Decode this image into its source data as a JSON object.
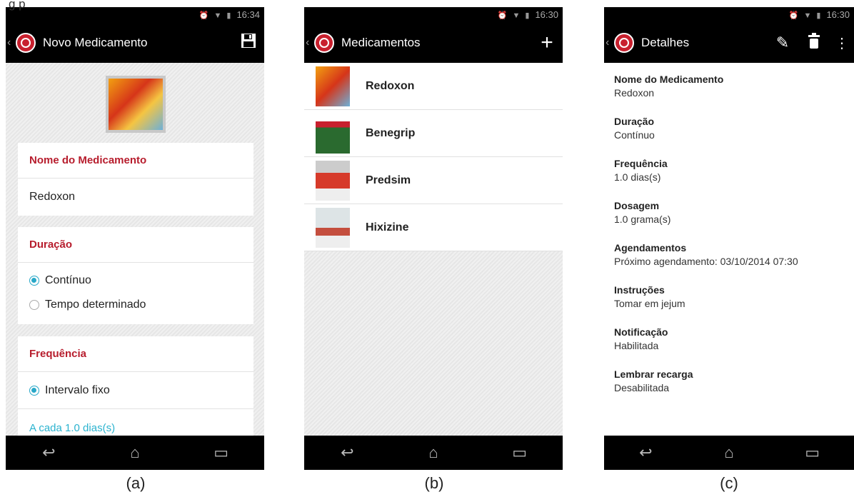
{
  "figure": {
    "caption_fragment": "g                             p",
    "panel_labels": [
      "(a)",
      "(b)",
      "(c)"
    ]
  },
  "panel_a": {
    "status_time": "16:34",
    "title": "Novo Medicamento",
    "save_icon": "save-icon",
    "sections": {
      "nome": {
        "header": "Nome do Medicamento",
        "value": "Redoxon"
      },
      "duracao": {
        "header": "Duração",
        "options": [
          "Contínuo",
          "Tempo determinado"
        ],
        "selected": 0
      },
      "frequencia": {
        "header": "Frequência",
        "option": "Intervalo fixo",
        "interval": "A cada 1.0 dias(s)"
      }
    }
  },
  "panel_b": {
    "status_time": "16:30",
    "title": "Medicamentos",
    "add_icon": "plus-icon",
    "items": [
      {
        "label": "Redoxon"
      },
      {
        "label": "Benegrip"
      },
      {
        "label": "Predsim"
      },
      {
        "label": "Hixizine"
      }
    ]
  },
  "panel_c": {
    "status_time": "16:30",
    "title": "Detalhes",
    "details": [
      {
        "label": "Nome do Medicamento",
        "value": "Redoxon"
      },
      {
        "label": "Duração",
        "value": "Contínuo"
      },
      {
        "label": "Frequência",
        "value": "1.0 dias(s)"
      },
      {
        "label": "Dosagem",
        "value": "1.0 grama(s)"
      },
      {
        "label": "Agendamentos",
        "value": "Próximo agendamento: 03/10/2014 07:30"
      },
      {
        "label": "Instruções",
        "value": "Tomar em jejum"
      },
      {
        "label": "Notificação",
        "value": "Habilitada"
      },
      {
        "label": "Lembrar recarga",
        "value": "Desabilitada"
      }
    ]
  },
  "colors": {
    "accent_red": "#b71d2d",
    "teal": "#2bb3cf",
    "radio_selected": "#29a8c8"
  }
}
